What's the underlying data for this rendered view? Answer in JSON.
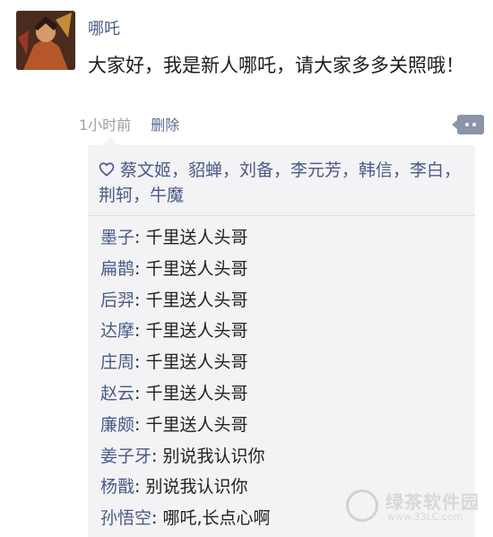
{
  "post": {
    "username": "哪吒",
    "text": "大家好，我是新人哪吒，请大家多多关照哦！",
    "time": "1小时前",
    "delete_label": "删除"
  },
  "likes": {
    "names": "蔡文姬，貂蝉，刘备，李元芳，韩信，李白，荆轲，牛魔"
  },
  "comments": [
    {
      "name": "墨子",
      "text": "千里送人头哥"
    },
    {
      "name": "扁鹊",
      "text": "千里送人头哥"
    },
    {
      "name": "后羿",
      "text": "千里送人头哥"
    },
    {
      "name": "达摩",
      "text": "千里送人头哥"
    },
    {
      "name": "庄周",
      "text": "千里送人头哥"
    },
    {
      "name": "赵云",
      "text": "千里送人头哥"
    },
    {
      "name": "廉颇",
      "text": "千里送人头哥"
    },
    {
      "name": "姜子牙",
      "text": "别说我认识你"
    },
    {
      "name": "杨戬",
      "text": "别说我认识你"
    },
    {
      "name": "孙悟空",
      "text": "哪吒,长点心啊"
    }
  ],
  "watermark": {
    "text": "绿茶软件园",
    "url": "www.33LC.com"
  },
  "colors": {
    "name_link": "#4a5a86",
    "panel_bg": "#f3f3f5",
    "meta_gray": "#9aa0a6"
  },
  "icons": {
    "heart": "heart-icon",
    "comment": "comment-dots-icon",
    "avatar": "avatar-image"
  }
}
